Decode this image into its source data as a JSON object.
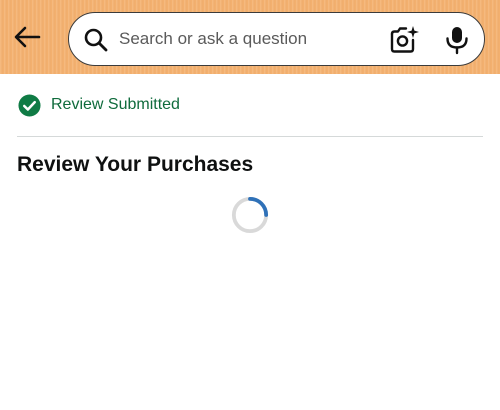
{
  "header": {
    "back_icon": "arrow-left-icon",
    "search": {
      "placeholder": "Search or ask a question",
      "search_icon": "magnifier-icon",
      "camera_icon": "camera-sparkle-icon",
      "mic_icon": "microphone-icon"
    },
    "background_color": "#f4b16f"
  },
  "status": {
    "icon": "check-circle-icon",
    "text": "Review Submitted",
    "color": "#0f6b3c"
  },
  "section": {
    "title": "Review Your Purchases"
  },
  "loading": {
    "icon": "spinner-icon",
    "accent_color": "#2f71b8"
  }
}
